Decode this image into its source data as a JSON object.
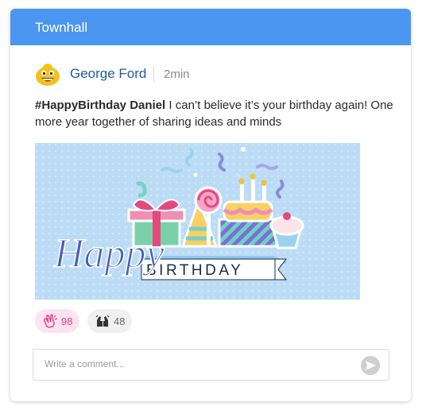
{
  "header": {
    "title": "Townhall"
  },
  "post": {
    "author": "George Ford",
    "time": "2min",
    "hashtag": "#HappyBirthday Daniel",
    "text": " I can’t believe it’s your birthday again! One more year together of sharing ideas and minds",
    "banner": {
      "script_word": "Happy",
      "block_word": "BIRTHDAY"
    }
  },
  "reactions": [
    {
      "icon": "clapping-hands-icon",
      "count": "98",
      "color": "#e6398a"
    },
    {
      "icon": "raised-hands-icon",
      "count": "48",
      "color": "#6b6b6b"
    }
  ],
  "comment": {
    "placeholder": "Write a comment..."
  },
  "colors": {
    "header": "#4a96f0",
    "author": "#1f5aa8",
    "banner_bg": "#bcdcf6"
  }
}
